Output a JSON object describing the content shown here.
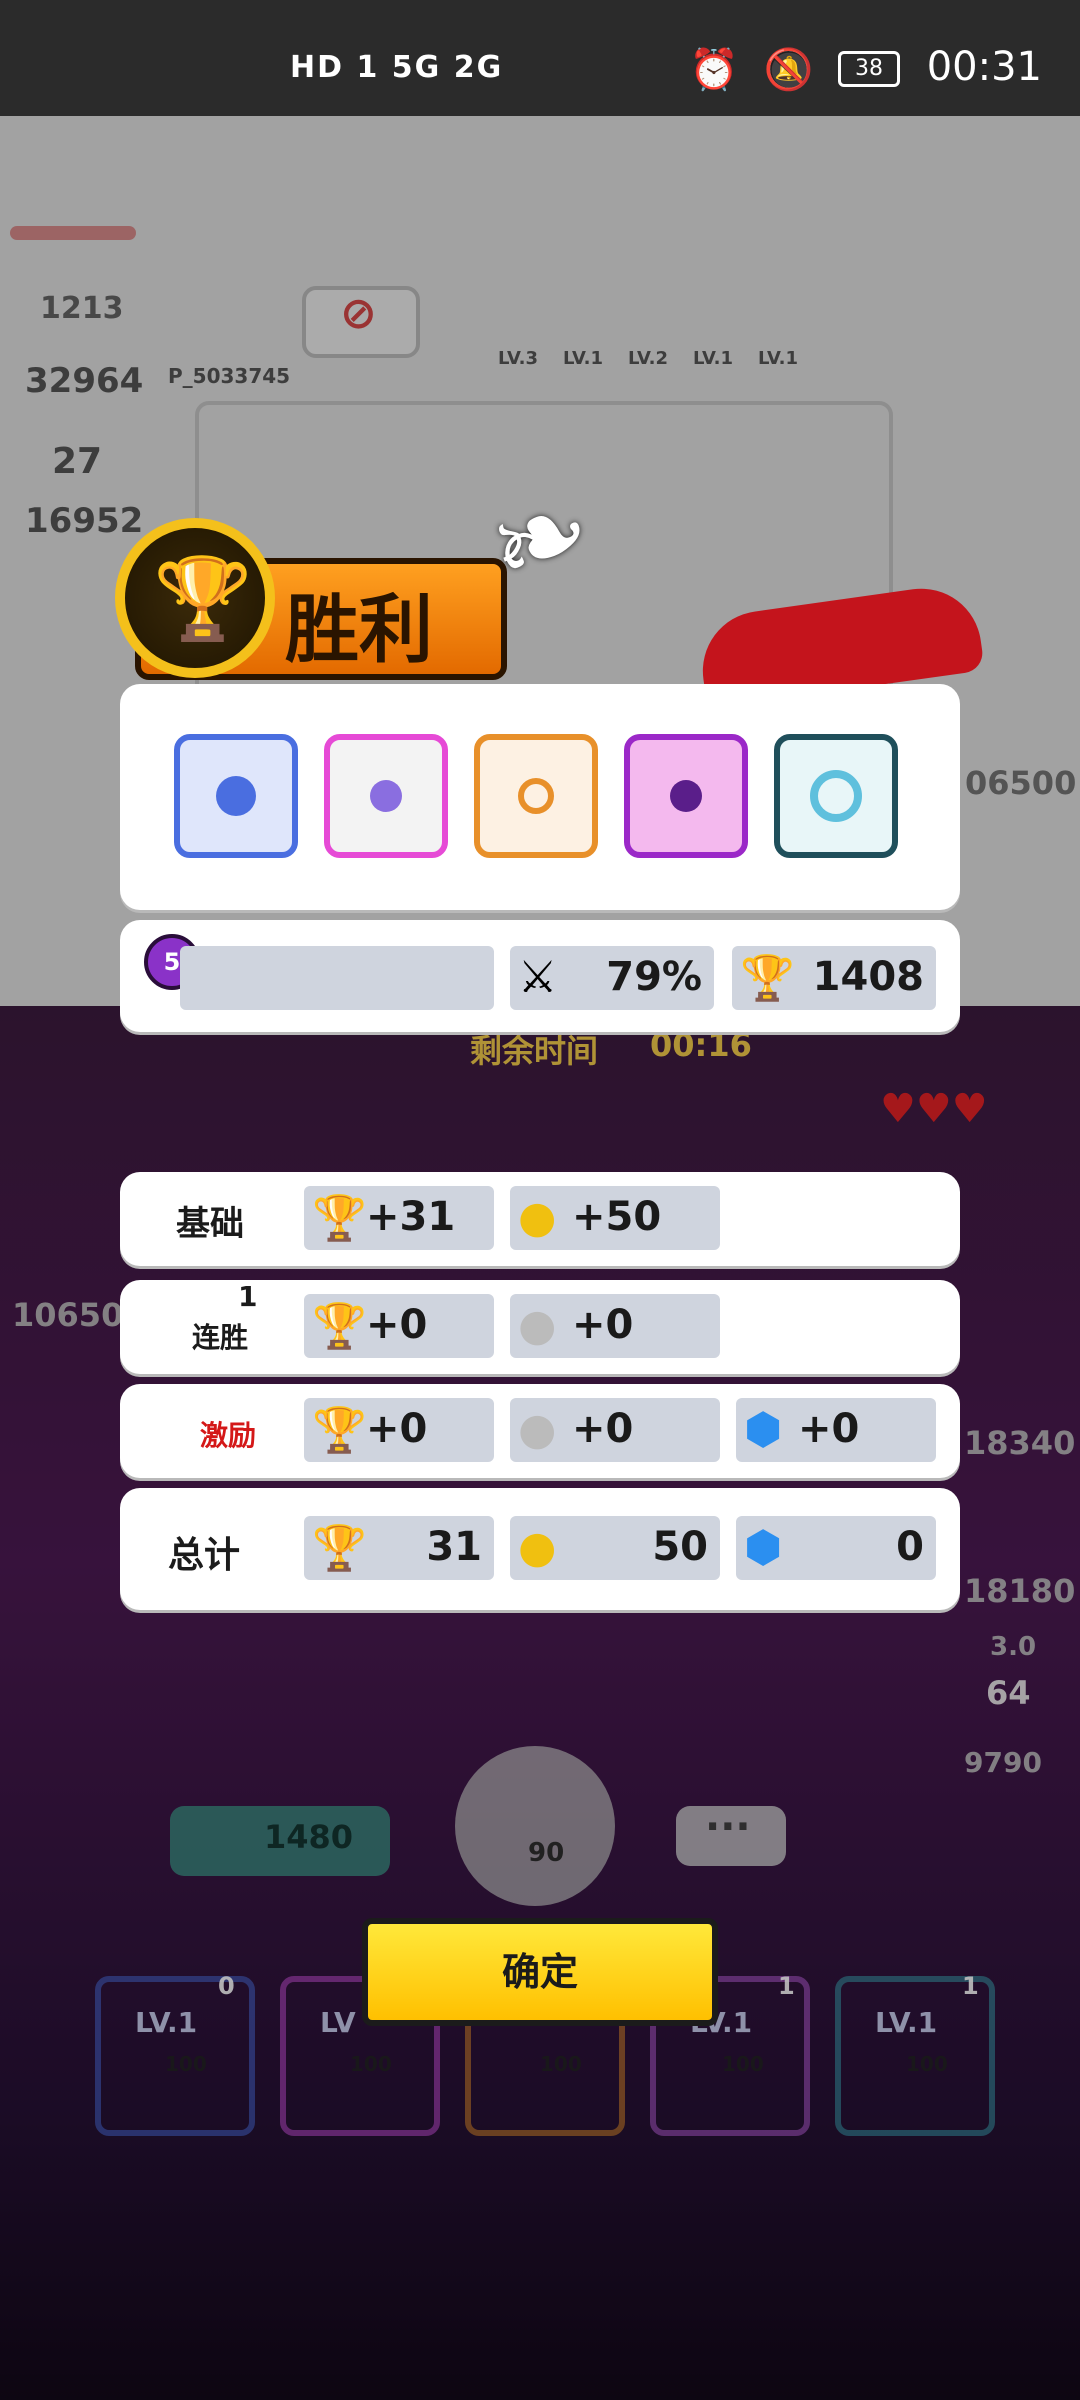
{
  "status_bar": {
    "left_icons": "HD 1 5G 2G",
    "battery": "38",
    "time": "00:31"
  },
  "background": {
    "player_name": "P_5033745",
    "hp_values": [
      "1213",
      "32964",
      "27",
      "16952"
    ],
    "dice_levels": [
      "LV.3",
      "LV.1",
      "LV.2",
      "LV.1",
      "LV.1"
    ],
    "right_scores": [
      "06500",
      "18340",
      "18180",
      "9790"
    ],
    "left_score": "10650",
    "timer_label": "剩余时间",
    "timer_value": "00:16",
    "mid_numbers": [
      "3.0",
      "64"
    ],
    "sp_total": "1480",
    "roll_cost": "90",
    "chat_label": "···",
    "deck": [
      {
        "level": "LV.1",
        "cost": "100",
        "count": "0"
      },
      {
        "level": "LV",
        "cost": "100",
        "count": ""
      },
      {
        "level": "",
        "cost": "100",
        "count": ""
      },
      {
        "level": "LV.1",
        "cost": "100",
        "count": "1"
      },
      {
        "level": "LV.1",
        "cost": "100",
        "count": "1"
      }
    ]
  },
  "victory": {
    "title": "胜利"
  },
  "dice_row": [
    "gear-blue",
    "rainbow",
    "orange-target",
    "magenta-arrow",
    "ice-swirl"
  ],
  "stats": {
    "rank_badge": "5",
    "win_rate": "79%",
    "trophies": "1408"
  },
  "rewards": [
    {
      "label": "基础",
      "trophy": "+31",
      "coin": "+50",
      "gem": null,
      "label_color": "#1b1b1b"
    },
    {
      "label": "连胜",
      "streak": "1",
      "trophy": "+0",
      "coin": "+0",
      "gem": null,
      "label_color": "#1b1b1b"
    },
    {
      "label": "激励",
      "trophy": "+0",
      "coin": "+0",
      "gem": "+0",
      "label_color": "#d41818"
    }
  ],
  "total": {
    "label": "总计",
    "trophy": "31",
    "coin": "50",
    "gem": "0"
  },
  "confirm_label": "确定"
}
